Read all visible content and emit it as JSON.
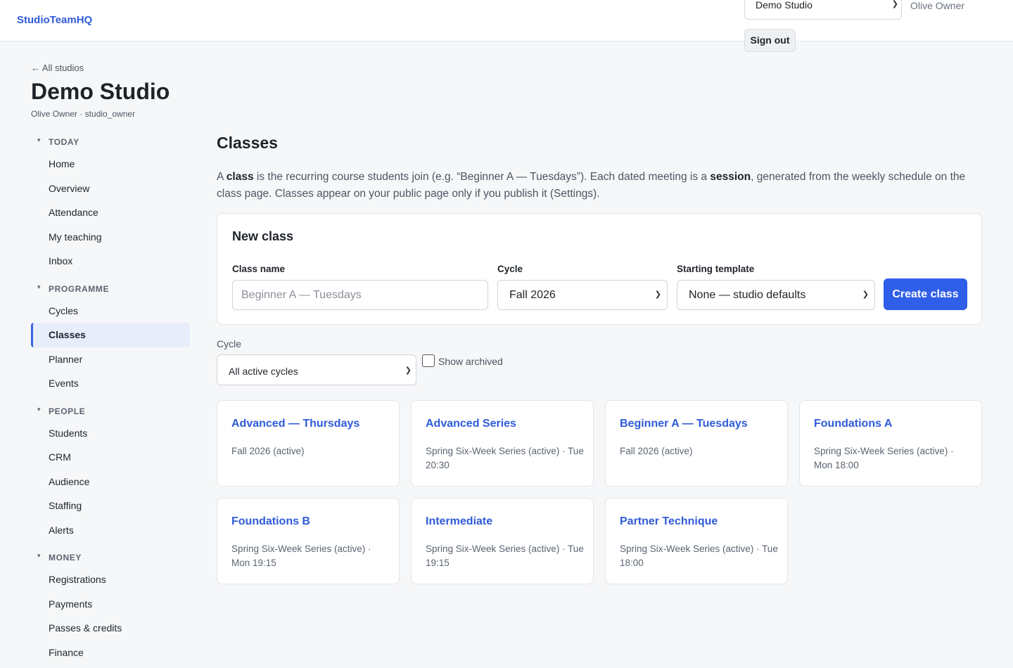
{
  "header": {
    "brand": "StudioTeamHQ",
    "studio_select": "Demo Studio",
    "user": "Olive Owner",
    "sign_out": "Sign out"
  },
  "studio": {
    "back_link": "← All studios",
    "title": "Demo Studio",
    "meta": "Olive Owner · studio_owner"
  },
  "sidebar": {
    "sections": [
      {
        "label": "TODAY",
        "items": [
          "Home",
          "Overview",
          "Attendance",
          "My teaching",
          "Inbox"
        ]
      },
      {
        "label": "PROGRAMME",
        "items": [
          "Cycles",
          "Classes",
          "Planner",
          "Events"
        ]
      },
      {
        "label": "PEOPLE",
        "items": [
          "Students",
          "CRM",
          "Audience",
          "Staffing",
          "Alerts"
        ]
      },
      {
        "label": "MONEY",
        "items": [
          "Registrations",
          "Payments",
          "Passes & credits",
          "Finance"
        ]
      }
    ],
    "active": "Classes"
  },
  "main": {
    "title": "Classes",
    "intro": {
      "p1": "A ",
      "b1": "class",
      "p2": " is the recurring course students join (e.g. “Beginner A — Tuesdays”). Each dated meeting is a ",
      "b2": "session",
      "p3": ", generated from the weekly schedule on the class page. Classes appear on your public page only if you publish it (Settings)."
    },
    "new_class": {
      "heading": "New class",
      "name_label": "Class name",
      "name_placeholder": "Beginner A — Tuesdays",
      "cycle_label": "Cycle",
      "cycle_value": "Fall 2026",
      "template_label": "Starting template",
      "template_value": "None — studio defaults",
      "create_button": "Create class"
    },
    "filter": {
      "label": "Cycle",
      "value": "All active cycles",
      "show_archived": "Show archived"
    },
    "classes": [
      {
        "name": "Advanced — Thursdays",
        "meta": "Fall 2026 (active)"
      },
      {
        "name": "Advanced Series",
        "meta": "Spring Six-Week Series (active) · Tue 20:30"
      },
      {
        "name": "Beginner A — Tuesdays",
        "meta": "Fall 2026 (active)"
      },
      {
        "name": "Foundations A",
        "meta": "Spring Six-Week Series (active) · Mon 18:00"
      },
      {
        "name": "Foundations B",
        "meta": "Spring Six-Week Series (active) · Mon 19:15"
      },
      {
        "name": "Intermediate",
        "meta": "Spring Six-Week Series (active) · Tue 19:15"
      },
      {
        "name": "Partner Technique",
        "meta": "Spring Six-Week Series (active) · Tue 18:00"
      }
    ]
  }
}
